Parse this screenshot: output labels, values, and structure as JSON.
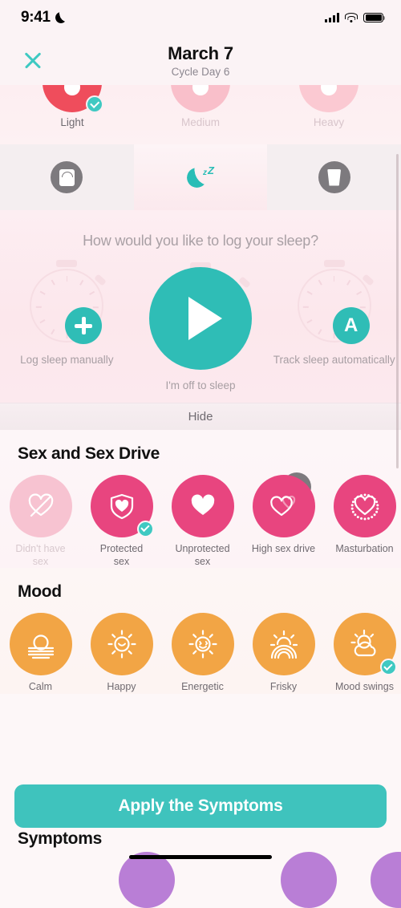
{
  "statusbar": {
    "time": "9:41",
    "moon_icon": "crescent-moon-icon",
    "signal_icon": "cellular-bars-icon",
    "wifi_icon": "wifi-icon",
    "battery_icon": "battery-full-icon"
  },
  "header": {
    "close_icon": "close-x-icon",
    "title": "March 7",
    "subtitle": "Cycle Day 6"
  },
  "flow": {
    "items": [
      {
        "label": "Light",
        "color": "#ef4d5c",
        "selected": true,
        "icon": "blood-drop-icon"
      },
      {
        "label": "Medium",
        "color": "#f9bfca",
        "selected": false,
        "icon": "blood-drop-icon"
      },
      {
        "label": "Heavy",
        "color": "#fbc9d2",
        "selected": false,
        "icon": "blood-drop-icon"
      }
    ],
    "selected_label_color": "#6f6a70",
    "unselected_label_color": "#d8c5cb"
  },
  "tabs": [
    {
      "name": "weight",
      "icon": "weight-scale-icon",
      "active": false
    },
    {
      "name": "sleep",
      "icon": "sleep-moon-zz-icon",
      "active": true
    },
    {
      "name": "water",
      "icon": "water-glass-icon",
      "active": false
    }
  ],
  "sleep": {
    "question": "How would you like to log your sleep?",
    "options": [
      {
        "label": "Log sleep manually",
        "icon": "stopwatch-plus-icon",
        "badge": "+"
      },
      {
        "label": "I'm off to sleep",
        "icon": "play-button-icon",
        "badge": ""
      },
      {
        "label": "Track sleep\nautomatically",
        "icon": "stopwatch-auto-icon",
        "badge": "A"
      }
    ],
    "hide_label": "Hide",
    "accent": "#2fbdb6"
  },
  "sex_section": {
    "title": "Sex and Sex Drive",
    "items": [
      {
        "label": "Didn't have\nsex",
        "icon": "heart-crossed-icon",
        "color": "#f7c3d1",
        "selected": false,
        "muted": true
      },
      {
        "label": "Protected\nsex",
        "icon": "shield-heart-icon",
        "color": "#e8457f",
        "selected": true,
        "muted": false
      },
      {
        "label": "Unprotected\nsex",
        "icon": "heart-filled-icon",
        "color": "#e8457f",
        "selected": false,
        "muted": false
      },
      {
        "label": "High sex drive",
        "icon": "heart-double-icon",
        "color": "#e8457f",
        "selected": false,
        "muted": false
      },
      {
        "label": "Masturbation",
        "icon": "heart-dotted-icon",
        "color": "#e8457f",
        "selected": false,
        "muted": false
      }
    ]
  },
  "mood_section": {
    "title": "Mood",
    "items": [
      {
        "label": "Calm",
        "icon": "sun-waves-icon",
        "color": "#f2a545",
        "selected": false
      },
      {
        "label": "Happy",
        "icon": "sun-smile-icon",
        "color": "#f2a545",
        "selected": false
      },
      {
        "label": "Energetic",
        "icon": "sun-energetic-icon",
        "color": "#f2a545",
        "selected": false
      },
      {
        "label": "Frisky",
        "icon": "sun-rainbow-icon",
        "color": "#f2a545",
        "selected": false
      },
      {
        "label": "Mood swings",
        "icon": "sun-cloud-icon",
        "color": "#f2a545",
        "selected": true
      }
    ]
  },
  "cta": {
    "label": "Apply the Symptoms",
    "color": "#3fc3bd"
  },
  "symptoms_section": {
    "title": "Symptoms"
  }
}
